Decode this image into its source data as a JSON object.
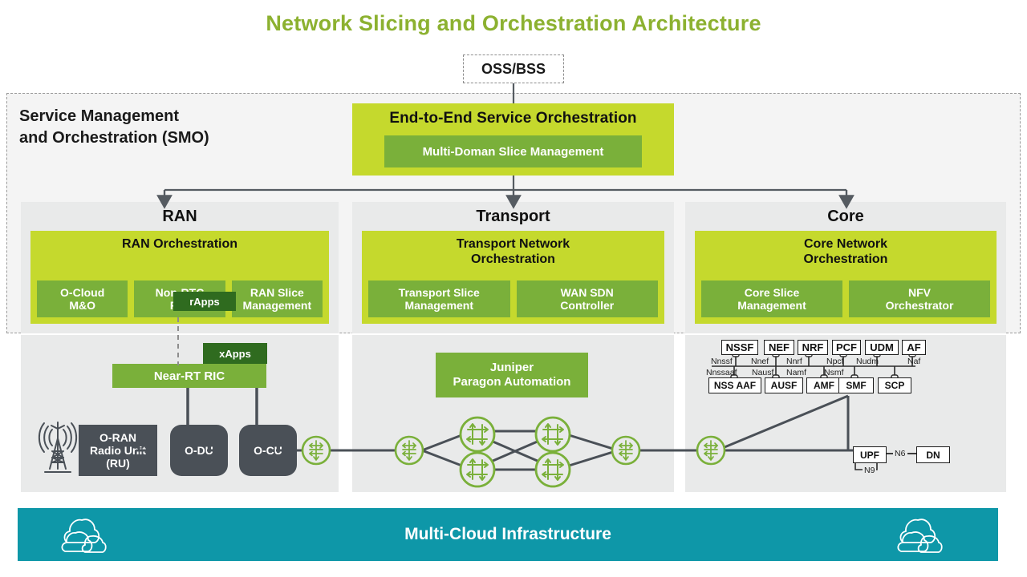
{
  "title": "Network Slicing and Orchestration Architecture",
  "colors": {
    "title_green": "#8cb130",
    "light_green": "#c5d92d",
    "mid_green": "#7ab03a",
    "dark_green": "#2f6b1f",
    "panel_grey": "#e9eaea",
    "smo_grey": "#f4f4f4",
    "node_grey": "#4a5057",
    "teal": "#0e97a8",
    "line_grey": "#555b61"
  },
  "ossbss": {
    "label": "OSS/BSS"
  },
  "smo": {
    "label_line1": "Service Management",
    "label_line2": "and Orchestration (SMO)",
    "e2e": {
      "title": "End-to-End Service Orchestration",
      "sub": "Multi-Doman Slice Management"
    }
  },
  "domains": [
    {
      "name": "RAN",
      "orchestration_title": "RAN Orchestration",
      "badge": "rApps",
      "items": [
        "O-Cloud\nM&O",
        "Non-RTC\nRIC",
        "RAN Slice\nManagement"
      ]
    },
    {
      "name": "Transport",
      "orchestration_title": "Transport Network\nOrchestration",
      "badge": "",
      "items": [
        "Transport Slice\nManagement",
        "WAN SDN\nController"
      ]
    },
    {
      "name": "Core",
      "orchestration_title": "Core Network\nOrchestration",
      "badge": "",
      "items": [
        "Core Slice\nManagement",
        "NFV\nOrchestrator"
      ]
    }
  ],
  "ran_lower": {
    "near_rt_ric": "Near-RT RIC",
    "xapps": "xApps",
    "ru": "O-RAN\nRadio Unit\n(RU)",
    "odu": "O-DU",
    "ocu": "O-CU",
    "antenna_icon": "antenna-tower-icon"
  },
  "transport_lower": {
    "controller": "Juniper\nParagon Automation",
    "router_icon": "router-icon",
    "switch_icon": "switch-icon",
    "routers": 4,
    "switches": 2
  },
  "core_lower": {
    "top_nfs": [
      "NSSF",
      "NEF",
      "NRF",
      "PCF",
      "UDM",
      "AF"
    ],
    "top_ifaces": [
      "Nnssf",
      "Nnef",
      "Nnrf",
      "Npcf",
      "Nudm",
      "Naf"
    ],
    "bottom_ifaces": [
      "Nnssaaf",
      "Nausf",
      "Namf",
      "Nsmf"
    ],
    "bottom_nfs": [
      "NSS AAF",
      "AUSF",
      "AMF",
      "SMF",
      "SCP"
    ],
    "upf": "UPF",
    "dn": "DN",
    "n6": "N6",
    "n9": "N9"
  },
  "cloudbar": {
    "label": "Multi-Cloud Infrastructure",
    "cloud_icon": "cloud-icon"
  }
}
